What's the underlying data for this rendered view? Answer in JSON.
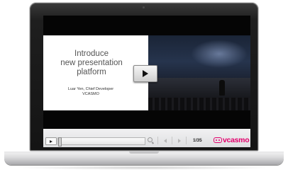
{
  "slide": {
    "title_lines": [
      "Introduce",
      "new presentation",
      "platform"
    ],
    "presenter": "Luar Yen, Chief Developer",
    "company": "VCASMO"
  },
  "player": {
    "page_counter": "1/35",
    "brand": "vcasmo",
    "brand_color": "#e4006d"
  },
  "icons": {
    "play_big": "play-icon",
    "play_small": "play-icon",
    "zoom": "magnifier-icon",
    "prev": "previous-icon",
    "next": "next-icon",
    "brand_logo": "vcasmo-logo-icon"
  },
  "seek": {
    "progress_fraction": 0.0
  }
}
